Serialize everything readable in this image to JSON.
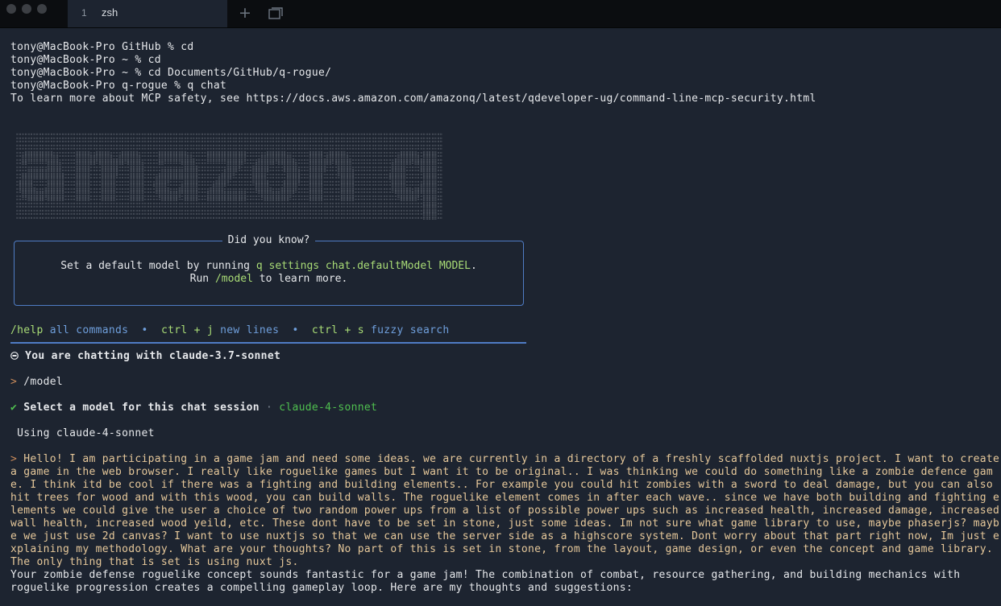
{
  "tabbar": {
    "tab_number": "1",
    "tab_title": "zsh",
    "new_tab_glyph": "+",
    "window_icon": "windows-icon"
  },
  "history": [
    "tony@MacBook-Pro GitHub % cd",
    "tony@MacBook-Pro ~ % cd",
    "tony@MacBook-Pro ~ % cd Documents/GitHub/q-rogue/",
    "tony@MacBook-Pro q-rogue % q chat",
    "To learn more about MCP safety, see https://docs.aws.amazon.com/amazonq/latest/qdeveloper-ug/command-line-mcp-security.html"
  ],
  "banner": {
    "text": "amazon q"
  },
  "did_you_know": {
    "title": "Did you know?",
    "line1_a": "Set a default model by running ",
    "line1_cmd": "q settings chat.defaultModel MODEL",
    "line1_b": ".",
    "line2_a": "Run ",
    "line2_cmd": "/model",
    "line2_b": " to learn more."
  },
  "hints": {
    "help_key": "/help",
    "help_label": " all commands",
    "sep": "  •  ",
    "newline_key": "ctrl + j",
    "newline_label": " new lines",
    "fuzzy_key": "ctrl + s",
    "fuzzy_label": " fuzzy search"
  },
  "chat": {
    "model_icon": "robot-icon",
    "chatting_with": " You are chatting with claude-3.7-sonnet",
    "prompt_mark": "> ",
    "model_command": "/model",
    "check_mark": "✔ ",
    "select_label": "Select a model for this chat session",
    "select_sep": " · ",
    "selected_model": "claude-4-sonnet",
    "using": " Using claude-4-sonnet",
    "user_message": "Hello! I am participating in a game jam and need some ideas. we are currently in a directory of a freshly scaffolded nuxtjs project. I want to create a game in the web browser. I really like roguelike games but I want it to be original.. I was thinking we could do something like a zombie defence game. I think itd be cool if there was a fighting and building elements.. For example you could hit zombies with a sword to deal damage, but you can also hit trees for wood and with this wood, you can build walls. The roguelike element comes in after each wave.. since we have both building and fighting elements we could give the user a choice of two random power ups from a list of possible power ups such as increased health, increased damage, increased wall health, increased wood yeild, etc. These dont have to be set in stone, just some ideas. Im not sure what game library to use, maybe phaserjs? maybe we just use 2d canvas? I want to use nuxtjs so that we can use the server side as a highscore system. Dont worry about that part right now, Im just explaining my methodology. What are your thoughts? No part of this is set in stone, from the layout, game design, or even the concept and game library. The only thing that is set is using nuxt js.",
    "assistant_reply": "Your zombie defense roguelike concept sounds fantastic for a game jam! The combination of combat, resource gathering, and building mechanics with\nroguelike progression creates a compelling gameplay loop. Here are my thoughts and suggestions:"
  }
}
